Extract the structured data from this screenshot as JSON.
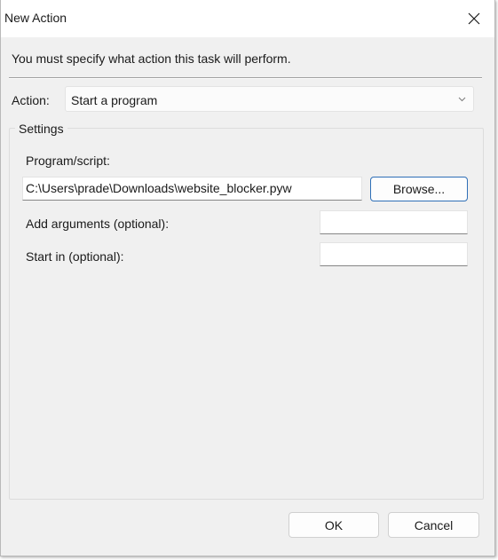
{
  "window": {
    "title": "New Action"
  },
  "instruction": "You must specify what action this task will perform.",
  "action": {
    "label": "Action:",
    "selected": "Start a program"
  },
  "settings": {
    "legend": "Settings",
    "program_label": "Program/script:",
    "program_value": "C:\\Users\\prade\\Downloads\\website_blocker.pyw",
    "browse_label": "Browse...",
    "arguments_label": "Add arguments (optional):",
    "arguments_value": "",
    "start_in_label": "Start in (optional):",
    "start_in_value": ""
  },
  "buttons": {
    "ok": "OK",
    "cancel": "Cancel"
  },
  "icons": {
    "close": "close-icon",
    "dropdown": "chevron-down-icon"
  }
}
